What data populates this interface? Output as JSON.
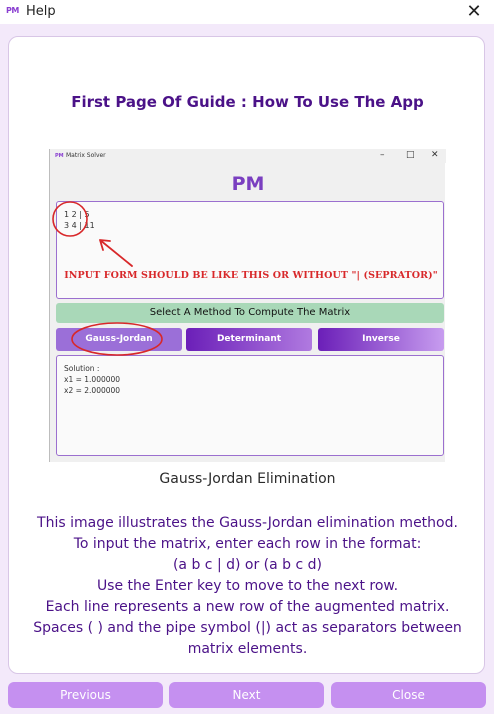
{
  "window": {
    "title": "Help",
    "icon_text": "PM"
  },
  "guide": {
    "title": "First Page Of Guide : How To Use The App",
    "caption": "Gauss-Jordan Elimination",
    "description": [
      "This image illustrates the Gauss-Jordan elimination method.",
      "To input the matrix, enter each row in the format:",
      "(a b c | d) or (a b c d)",
      "Use the Enter key to move to the next row.",
      "Each line represents a new row of the augmented matrix.",
      "Spaces ( ) and the pipe symbol (|) act as separators between",
      "matrix elements."
    ]
  },
  "screenshot": {
    "window_title": "Matrix Solver",
    "icon_text": "PM",
    "app_logo": "PM",
    "input_lines": [
      "1 2 | 5",
      "3 4 | 11"
    ],
    "annotation": "INPUT FORM SHOULD BE LIKE THIS OR WITHOUT \"| (SEPRATOR)\"",
    "select_label": "Select A Method To Compute The Matrix",
    "methods": [
      "Gauss-Jordan",
      "Determinant",
      "Inverse"
    ],
    "output_lines": [
      "Solution :",
      "x1 = 1.000000",
      "x2 = 2.000000"
    ],
    "controls": [
      "–",
      "□",
      "✕"
    ]
  },
  "buttons": {
    "previous": "Previous",
    "next": "Next",
    "close": "Close"
  },
  "colors": {
    "accent": "#c590f0",
    "title_purple": "#4b1288",
    "annotation_red": "#d8282a",
    "select_green": "#a9d8b8"
  },
  "icons": {
    "close": "close-icon",
    "app": "app-logo-icon"
  }
}
